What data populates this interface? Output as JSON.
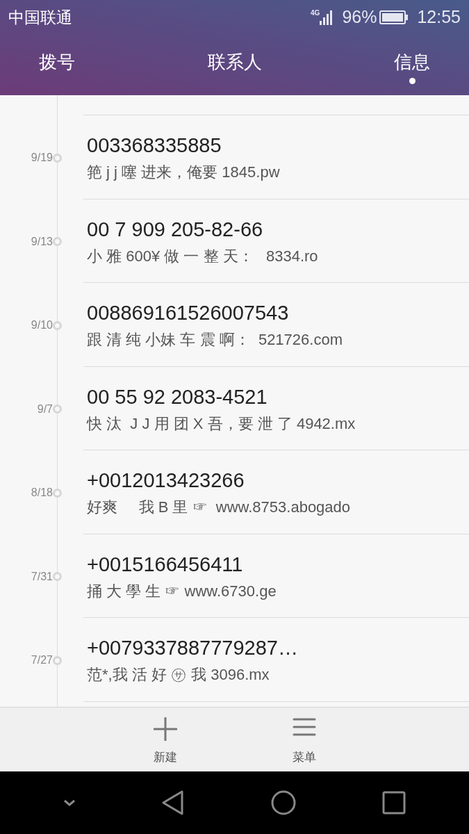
{
  "status_bar": {
    "carrier": "中国联通",
    "network": "4G",
    "battery": "96%",
    "time": "12:55"
  },
  "tabs": [
    {
      "label": "拨号",
      "selected": false
    },
    {
      "label": "联系人",
      "selected": false
    },
    {
      "label": "信息",
      "selected": true
    }
  ],
  "messages": [
    {
      "date": "9/19",
      "sender": "003368335885",
      "preview": "筢 j j 噻 进来，俺要 1845.pw"
    },
    {
      "date": "9/13",
      "sender": "00 7 909 205-82-66",
      "preview": "小 雅 600¥ 做 一 整 天：   8334.ro"
    },
    {
      "date": "9/10",
      "sender": "008869161526007543",
      "preview": "跟 清 纯 小妹 车 震 啊：  521726.com"
    },
    {
      "date": "9/7",
      "sender": "00 55 92 2083-4521",
      "preview": "快 汰  J J 用 团 X 吾，要 泄 了 4942.mx"
    },
    {
      "date": "8/18",
      "sender": "+0012013423266",
      "preview": "好爽     我 B 里 ☞  www.8753.abogado"
    },
    {
      "date": "7/31",
      "sender": "+0015166456411",
      "preview": "捅 大 學 生 ☞ www.6730.ge"
    },
    {
      "date": "7/27",
      "sender": "+0079337887779287…",
      "preview": "范*,我 活 好 ㋚ 我 3096.mx"
    }
  ],
  "bottom_actions": [
    {
      "kind": "new",
      "label": "新建"
    },
    {
      "kind": "menu",
      "label": "菜单"
    }
  ]
}
